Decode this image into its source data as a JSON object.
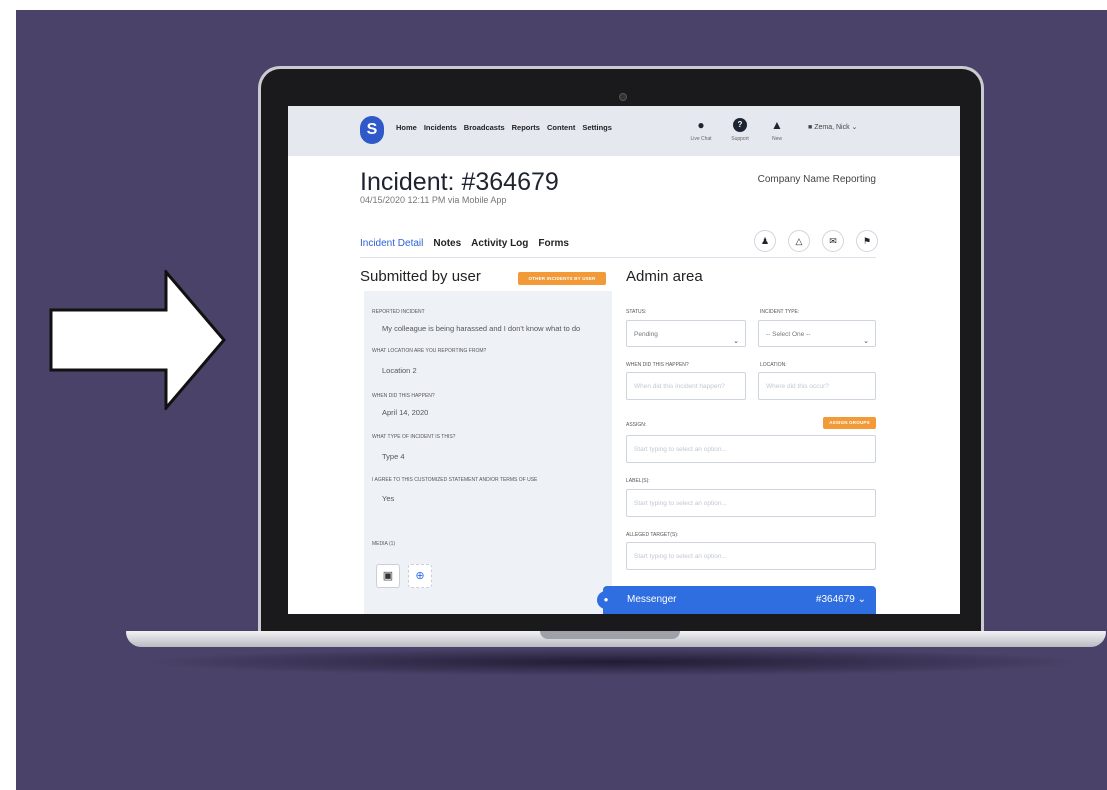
{
  "app": {
    "logo_letter": "S",
    "nav": [
      "Home",
      "Incidents",
      "Broadcasts",
      "Reports",
      "Content",
      "Settings"
    ],
    "tools": [
      {
        "icon": "chat-bubble-icon",
        "label": "Live Chat"
      },
      {
        "icon": "question-icon",
        "label": "Support"
      },
      {
        "icon": "bell-icon",
        "label": "New"
      }
    ],
    "user_name": "Zema, Nick"
  },
  "incident": {
    "title": "Incident: #364679",
    "subtitle": "04/15/2020 12:11 PM   via Mobile App",
    "company": "Company Name Reporting"
  },
  "tabs": [
    "Incident Detail",
    "Notes",
    "Activity Log",
    "Forms"
  ],
  "header_actions": [
    "person-icon",
    "thumb-icon",
    "mail-icon",
    "flag-icon"
  ],
  "submitted": {
    "heading": "Submitted by user",
    "other_button": "OTHER INCIDENTS BY USER",
    "fields": [
      {
        "label": "REPORTED INCIDENT",
        "value": "My colleague is being harassed and I don't know what to do"
      },
      {
        "label": "WHAT LOCATION ARE YOU REPORTING FROM?",
        "value": "Location 2"
      },
      {
        "label": "WHEN DID THIS HAPPEN?",
        "value": "April 14, 2020"
      },
      {
        "label": "WHAT TYPE OF INCIDENT IS THIS?",
        "value": "Type 4"
      },
      {
        "label": "I AGREE TO THIS CUSTOMIZED STATEMENT AND/OR TERMS OF USE",
        "value": "Yes"
      }
    ],
    "media_label": "MEDIA (1)"
  },
  "admin": {
    "heading": "Admin area",
    "status_label": "STATUS:",
    "status_value": "Pending",
    "type_label": "INCIDENT TYPE:",
    "type_value": "-- Select One --",
    "when_label": "WHEN DID THIS HAPPEN?",
    "when_placeholder": "When did this incident happen?",
    "location_label": "LOCATION:",
    "location_placeholder": "Where did this occur?",
    "assign_label": "ASSIGN:",
    "assign_button": "ASSIGN GROUPS",
    "assign_placeholder": "Start typing to select an option...",
    "labels_label": "LABEL(S):",
    "labels_placeholder": "Start typing to select an option...",
    "targets_label": "ALLEGED TARGET(S):",
    "targets_placeholder": "Start typing to select an option..."
  },
  "messenger": {
    "title": "Messenger",
    "number": "#364679"
  },
  "colors": {
    "background": "#4a4268",
    "accent": "#2f6ee0",
    "orange": "#f29a38"
  }
}
